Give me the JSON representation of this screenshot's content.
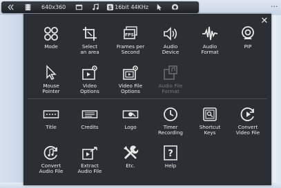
{
  "toolbar": {
    "resolution": "640x360",
    "audio_format": "16bit 44KHz"
  },
  "ellipsis": "...",
  "close_glyph": "✕",
  "panel": {
    "section1": [
      {
        "label": "Mode",
        "icon": "grid-circles-icon"
      },
      {
        "label": "Select\nan area",
        "icon": "select-area-icon"
      },
      {
        "label": "Frames per\nSecond",
        "icon": "fps-icon"
      },
      {
        "label": "Audio\nDevice",
        "icon": "speaker-icon"
      },
      {
        "label": "Audio\nFormat",
        "icon": "waveform-icon"
      },
      {
        "label": "PIP",
        "icon": "webcam-icon"
      },
      {
        "label": "Mouse\nPointer",
        "icon": "mouse-pointer-icon"
      },
      {
        "label": "Video\nOptions",
        "icon": "video-gear-icon"
      },
      {
        "label": "Video File\nOptions",
        "icon": "video-file-gear-icon"
      },
      {
        "label": "Audio File\nFormat",
        "icon": "audio-file-icon",
        "disabled": true
      }
    ],
    "section2": [
      {
        "label": "Title",
        "icon": "title-text-icon"
      },
      {
        "label": "Credits",
        "icon": "credits-icon"
      },
      {
        "label": "Logo",
        "icon": "logo-icon"
      },
      {
        "label": "Timer\nRecording",
        "icon": "timer-icon"
      },
      {
        "label": "Shortcut\nKeys",
        "icon": "shortcut-keys-icon"
      },
      {
        "label": "Convert\nVideo File",
        "icon": "convert-video-icon"
      },
      {
        "label": "Convert\nAudio File",
        "icon": "convert-audio-icon"
      },
      {
        "label": "Extract\nAudio File",
        "icon": "extract-audio-icon"
      },
      {
        "label": "Etc.",
        "icon": "tools-icon"
      },
      {
        "label": "Help",
        "icon": "help-icon"
      }
    ]
  }
}
